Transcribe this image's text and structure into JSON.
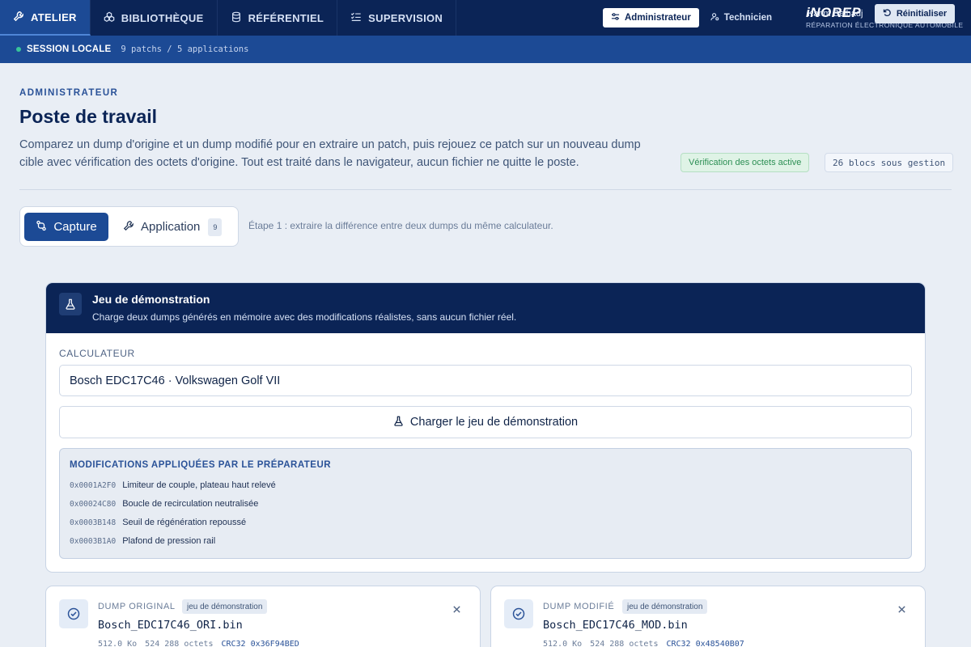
{
  "nav": {
    "tabs": [
      {
        "label": "ATELIER",
        "icon": "wrench-icon"
      },
      {
        "label": "BIBLIOTHÈQUE",
        "icon": "cubes-icon"
      },
      {
        "label": "RÉFÉRENTIEL",
        "icon": "database-icon"
      },
      {
        "label": "SUPERVISION",
        "icon": "checklist-icon"
      }
    ],
    "active_tab": "ATELIER",
    "modes": [
      {
        "label": "Administrateur",
        "icon": "sliders-icon",
        "active": true
      },
      {
        "label": "Technicien",
        "icon": "user-gear-icon",
        "active": false
      }
    ],
    "brand": {
      "name": "iNOREP",
      "subtitle": "RÉPARATION ÉLECTRONIQUE AUTOMOBILE"
    }
  },
  "session": {
    "label": "SESSION LOCALE",
    "stats": "9 patchs / 5 applications",
    "user": "Karim Belhadj",
    "reset_label": "Réinitialiser",
    "status_color": "#38c59a"
  },
  "header": {
    "eyebrow": "ADMINISTRATEUR",
    "title": "Poste de travail",
    "description": "Comparez un dump d'origine et un dump modifié pour en extraire un patch, puis rejouez ce patch sur un nouveau dump cible avec vérification des octets d'origine. Tout est traité dans le navigateur, aucun fichier ne quitte le poste.",
    "badge_verification": "Vérification des octets active",
    "badge_blocks": "26 blocs sous gestion"
  },
  "steps": {
    "capture_label": "Capture",
    "application_label": "Application",
    "application_count": "9",
    "hint": "Étape 1 : extraire la différence entre deux dumps du même calculateur."
  },
  "demo": {
    "title": "Jeu de démonstration",
    "subtitle": "Charge deux dumps générés en mémoire avec des modifications réalistes, sans aucun fichier réel.",
    "calc_label": "CALCULATEUR",
    "calc_value": "Bosch EDC17C46 · Volkswagen Golf VII",
    "load_label": "Charger le jeu de démonstration",
    "mods_title": "MODIFICATIONS APPLIQUÉES PAR LE PRÉPARATEUR",
    "mods": [
      {
        "addr": "0x0001A2F0",
        "desc": "Limiteur de couple, plateau haut relevé"
      },
      {
        "addr": "0x00024C80",
        "desc": "Boucle de recirculation neutralisée"
      },
      {
        "addr": "0x0003B148",
        "desc": "Seuil de régénération repoussé"
      },
      {
        "addr": "0x0003B1A0",
        "desc": "Plafond de pression rail"
      }
    ]
  },
  "dumps": {
    "original": {
      "label": "DUMP ORIGINAL",
      "tag": "jeu de démonstration",
      "file": "Bosch_EDC17C46_ORI.bin",
      "size": "512.0 Ko",
      "bytes": "524 288 octets",
      "crc": "CRC32 0x36F94BED"
    },
    "modified": {
      "label": "DUMP MODIFIÉ",
      "tag": "jeu de démonstration",
      "file": "Bosch_EDC17C46_MOD.bin",
      "size": "512.0 Ko",
      "bytes": "524 288 octets",
      "crc": "CRC32 0x48540B07"
    }
  }
}
